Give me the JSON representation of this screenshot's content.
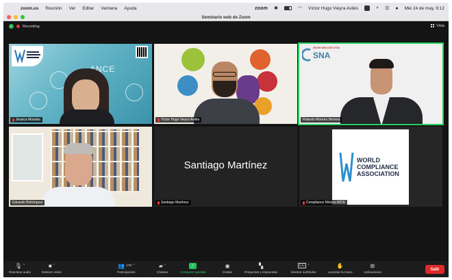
{
  "menubar": {
    "app": "zoom.us",
    "items": [
      "Reunión",
      "Ver",
      "Editar",
      "Ventana",
      "Ayuda"
    ],
    "zoom_logo": "zoom",
    "user": "Víctor Hugo Vieyra Avilés",
    "datetime": "Mié 24 de may. 9:12"
  },
  "window": {
    "title": "Seminario web de Zoom"
  },
  "meeting": {
    "recording_label": "Recording",
    "view_label": "Vista"
  },
  "tiles": [
    {
      "name": "Jessica Morales",
      "background_text": "ANCE"
    },
    {
      "name": "Víctor Hugo Vieyra Avilés"
    },
    {
      "name": "Roberto Moreno Herrera",
      "logo_small": "SECRETARÍA EJECUTIVA",
      "logo_text": "SNA"
    },
    {
      "name": "Eduardo Bohórquez"
    },
    {
      "name": "Santiago Martínez",
      "display_name": "Santiago Martínez"
    },
    {
      "name": "Compliance México WCA",
      "logo_lines": [
        "WORLD",
        "COMPLIANCE",
        "ASSOCIATION"
      ]
    }
  ],
  "toolbar": {
    "unmute": "Reactivar audio",
    "stop_video": "Detener vídeo",
    "participants": "Participantes",
    "participants_count": "178",
    "chat": "Chatear",
    "share": "Compartir pantalla",
    "record": "Grabar",
    "qa": "Preguntas y respuestas",
    "captions": "Mostrar subtítulos",
    "raise_hand": "Levantar la mano",
    "apps": "Aplicaciones",
    "leave": "Salir"
  },
  "colors": {
    "active_speaker": "#23d160",
    "leave_button": "#e02828",
    "share_button": "#23c55e",
    "recording_dot": "#e53935"
  }
}
